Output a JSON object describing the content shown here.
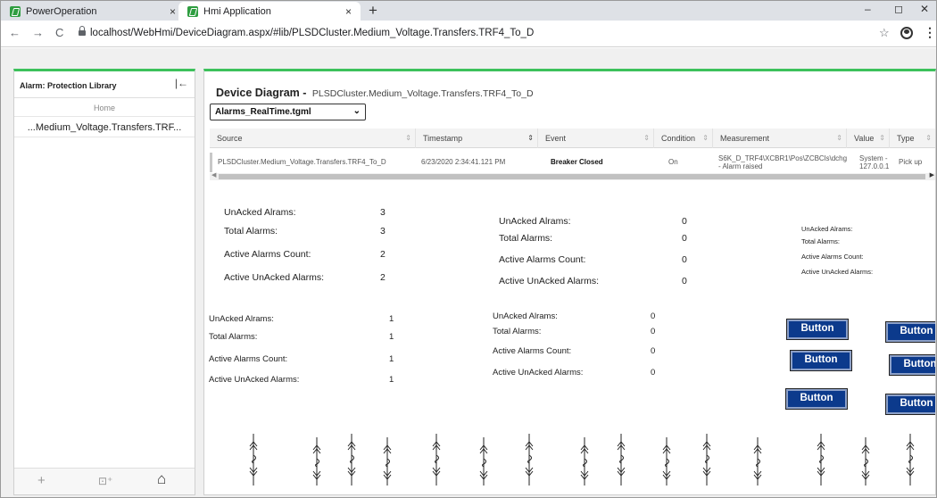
{
  "browser": {
    "tabs": [
      {
        "label": "PowerOperation",
        "close": "×"
      },
      {
        "label": "Hmi Application",
        "close": "×"
      }
    ],
    "new_tab": "+",
    "window_controls": {
      "minimize": "–",
      "restore": "◻",
      "close": "✕"
    },
    "nav": {
      "back": "←",
      "forward": "→",
      "reload": "C"
    },
    "url": "localhost/WebHmi/DeviceDiagram.aspx/#lib/PLSDCluster.Medium_Voltage.Transfers.TRF4_To_D",
    "star": "☆",
    "menu": "⋮"
  },
  "sidebar": {
    "title": "Alarm: Protection Library",
    "collapse_icon": "|←",
    "home": "Home",
    "tree_item": "...Medium_Voltage.Transfers.TRF...",
    "footer": {
      "add": "+",
      "new_folder": "⊡⁺",
      "home": "⌂"
    }
  },
  "main": {
    "title": "Device Diagram -",
    "path": "PLSDCluster.Medium_Voltage.Transfers.TRF4_To_D",
    "selected_file": "Alarms_RealTime.tgml",
    "grid": {
      "headers": [
        "Source",
        "Timestamp",
        "Event",
        "Condition",
        "Measurement",
        "Value",
        "Type"
      ],
      "row": {
        "source": "PLSDCluster.Medium_Voltage.Transfers.TRF4_To_D",
        "timestamp": "6/23/2020 2:34:41.121 PM",
        "event": "Breaker Closed",
        "condition": "On",
        "measurement": "S6K_D_TRF4\\XCBR1\\Pos\\ZCBCls\\dchg - Alarm raised",
        "value": "System - 127.0.0.1",
        "type": "Pick up"
      }
    },
    "counter_labels": {
      "unacked": "UnAcked Alrams:",
      "total": "Total Alarms:",
      "active": "Active Alarms Count:",
      "active_unacked": "Active UnAcked Alarms:"
    },
    "counters": [
      {
        "unacked": "3",
        "total": "3",
        "active": "2",
        "active_unacked": "2"
      },
      {
        "unacked": "0",
        "total": "0",
        "active": "0",
        "active_unacked": "0"
      },
      {
        "unacked": "1",
        "total": "1",
        "active": "1",
        "active_unacked": "1"
      },
      {
        "unacked": "0",
        "total": "0",
        "active": "0",
        "active_unacked": "0"
      }
    ],
    "button_label": "Button",
    "breaker_symbol_count": 17
  }
}
